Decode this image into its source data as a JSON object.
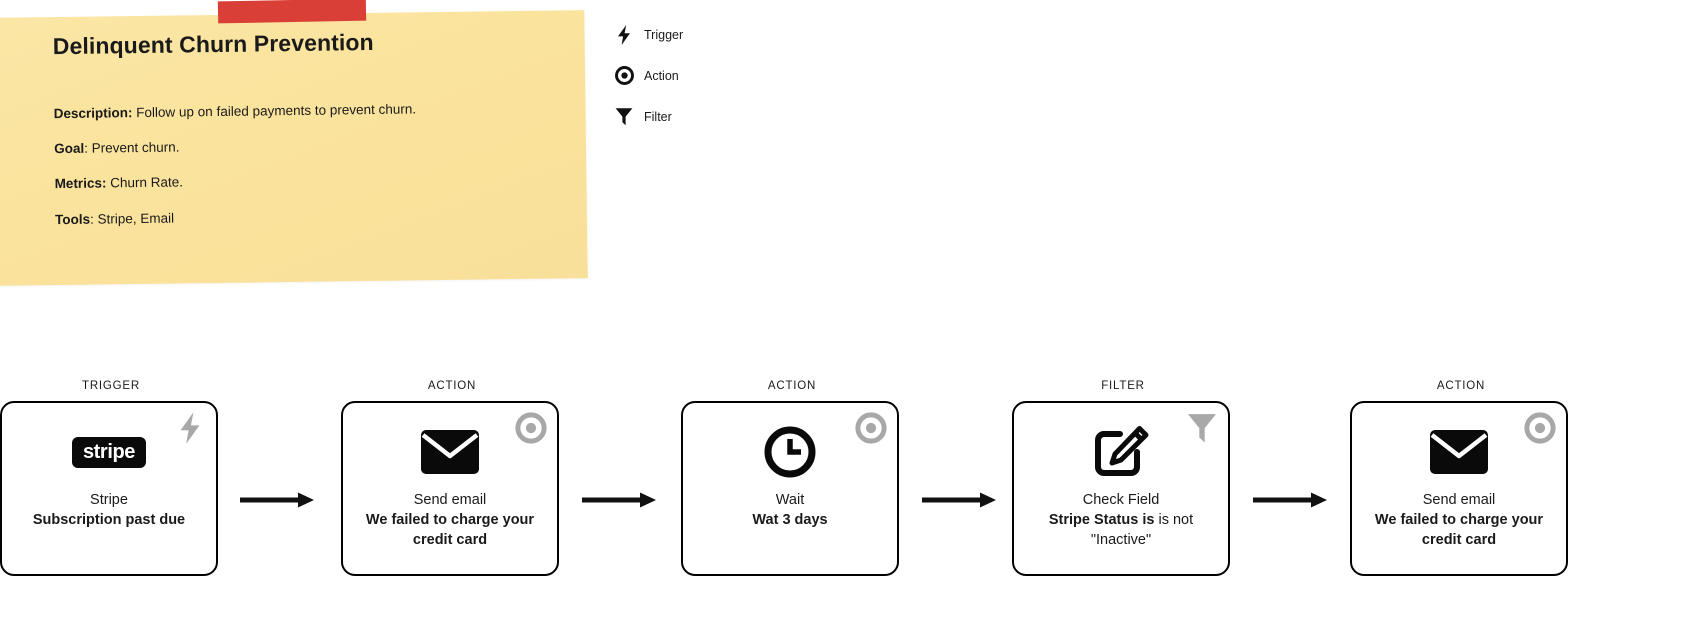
{
  "note": {
    "title": "Delinquent Churn Prevention",
    "lines": [
      {
        "label": "Description:",
        "value": " Follow up on failed payments to prevent churn."
      },
      {
        "label": "Goal",
        "value": ": Prevent churn."
      },
      {
        "label": "Metrics:",
        "value": " Churn Rate."
      },
      {
        "label": "Tools",
        "value": ": Stripe, Email"
      }
    ],
    "paper_color": "#f9e3a0",
    "tape_color": "#d93f36"
  },
  "legend": {
    "items": [
      {
        "icon": "lightning-bolt-icon",
        "label": "Trigger"
      },
      {
        "icon": "target-icon",
        "label": "Action"
      },
      {
        "icon": "funnel-icon",
        "label": "Filter"
      }
    ]
  },
  "flow": {
    "accent_gray": "#a8a8a8",
    "nodes": [
      {
        "kind": "TRIGGER",
        "corner_icon": "lightning-bolt-icon",
        "main_icon": "stripe-logo",
        "logo_text": "stripe",
        "subtitle": "Stripe",
        "title": "Subscription past due",
        "title_tail": ""
      },
      {
        "kind": "ACTION",
        "corner_icon": "target-icon",
        "main_icon": "envelope-icon",
        "subtitle": "Send email",
        "title": "We failed to charge your credit card",
        "title_tail": ""
      },
      {
        "kind": "ACTION",
        "corner_icon": "target-icon",
        "main_icon": "clock-icon",
        "subtitle": "Wait",
        "title": "Wat 3 days",
        "title_tail": ""
      },
      {
        "kind": "FILTER",
        "corner_icon": "funnel-icon",
        "main_icon": "edit-field-icon",
        "subtitle": "Check Field",
        "title": "Stripe Status is",
        "title_tail": " is not \"Inactive\""
      },
      {
        "kind": "ACTION",
        "corner_icon": "target-icon",
        "main_icon": "envelope-icon",
        "subtitle": "Send email",
        "title": "We failed to charge your credit card",
        "title_tail": ""
      }
    ]
  }
}
